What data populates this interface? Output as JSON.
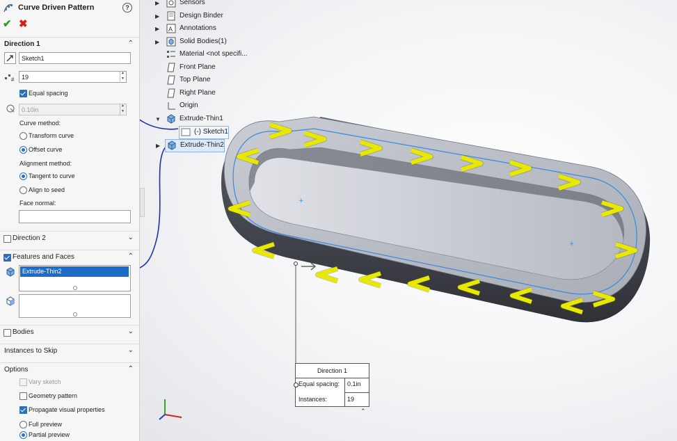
{
  "property_manager": {
    "title": "Curve Driven Pattern",
    "direction1": {
      "header": "Direction 1",
      "curve_value": "Sketch1",
      "instances_value": "19",
      "equal_spacing_label": "Equal spacing",
      "equal_spacing_checked": true,
      "spacing_value": "0.10in",
      "curve_method_label": "Curve method:",
      "transform_curve_label": "Transform curve",
      "offset_curve_label": "Offset curve",
      "alignment_method_label": "Alignment method:",
      "tangent_label": "Tangent to curve",
      "align_seed_label": "Align to seed",
      "face_normal_label": "Face normal:"
    },
    "direction2_header": "Direction 2",
    "features_header": "Features and Faces",
    "features_item": "Extrude-Thin2",
    "bodies_header": "Bodies",
    "instances_skip_header": "Instances to Skip",
    "options": {
      "header": "Options",
      "vary_sketch": "Vary sketch",
      "geometry_pattern": "Geometry pattern",
      "propagate": "Propagate visual properties",
      "full_preview": "Full preview",
      "partial_preview": "Partial preview"
    }
  },
  "feature_tree": [
    {
      "label": "Sensors",
      "expandable": true,
      "icon": "sensor-icon"
    },
    {
      "label": "Design Binder",
      "expandable": true,
      "icon": "binder-icon"
    },
    {
      "label": "Annotations",
      "expandable": true,
      "icon": "annotation-icon"
    },
    {
      "label": "Solid Bodies(1)",
      "expandable": true,
      "icon": "solid-bodies-icon"
    },
    {
      "label": "Material <not specifi...",
      "expandable": false,
      "icon": "material-icon"
    },
    {
      "label": "Front Plane",
      "expandable": false,
      "icon": "plane-icon"
    },
    {
      "label": "Top Plane",
      "expandable": false,
      "icon": "plane-icon"
    },
    {
      "label": "Right Plane",
      "expandable": false,
      "icon": "plane-icon"
    },
    {
      "label": "Origin",
      "expandable": false,
      "icon": "origin-icon"
    },
    {
      "label": "Extrude-Thin1",
      "expandable": true,
      "expanded": true,
      "icon": "extrude-icon"
    },
    {
      "label": "(-) Sketch1",
      "expandable": false,
      "icon": "sketch-icon",
      "child": true
    },
    {
      "label": "Extrude-Thin2",
      "expandable": true,
      "icon": "extrude-icon",
      "selected": true
    }
  ],
  "callout": {
    "title": "Direction 1",
    "row1_label": "Equal spacing:",
    "row1_value": "0.1in",
    "row2_label": "Instances:",
    "row2_value": "19"
  },
  "colors": {
    "accent": "#2d6fb8",
    "annotation_arrow": "#1a2fb5",
    "pattern_highlight": "#f0f000"
  }
}
